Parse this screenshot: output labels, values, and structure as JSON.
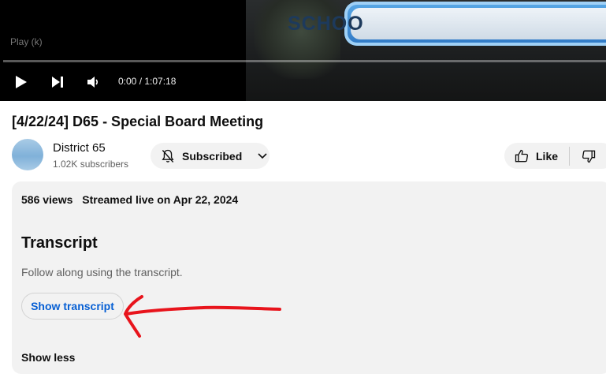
{
  "player": {
    "tooltip": "Play (k)",
    "time": "0:00 / 1:07:18",
    "progress_fraction": 0.0,
    "banner_text": "SCHOO",
    "icons": [
      "play-icon",
      "next-icon",
      "volume-icon"
    ]
  },
  "video": {
    "title": "[4/22/24] D65 - Special Board Meeting"
  },
  "channel": {
    "name": "District 65",
    "subscribers": "1.02K subscribers"
  },
  "actions": {
    "subscribe_label": "Subscribed",
    "like_label": "Like"
  },
  "description": {
    "views": "586 views",
    "streamed": "Streamed live on Apr 22, 2024",
    "transcript_heading": "Transcript",
    "transcript_desc": "Follow along using the transcript.",
    "show_transcript_label": "Show transcript",
    "show_less_label": "Show less"
  },
  "colors": {
    "accent_link": "#065fd4",
    "annotation_arrow": "#e8141c",
    "button_bg": "#f2f2f2"
  }
}
